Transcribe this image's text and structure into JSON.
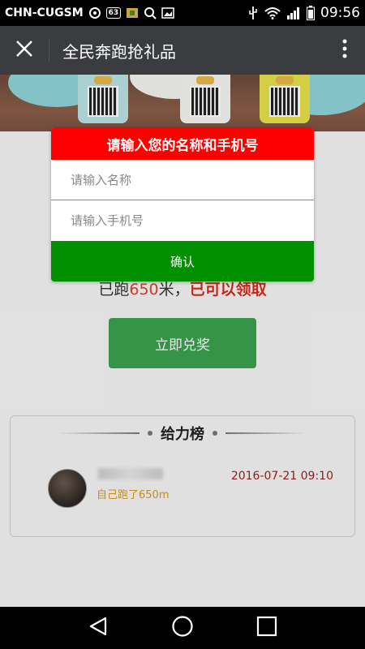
{
  "status_bar": {
    "carrier": "CHN-CUGSM",
    "notification_badge": "63",
    "time": "09:56",
    "icons": [
      "sync-icon",
      "notification-count-icon",
      "app-box-icon",
      "search-icon",
      "image-icon",
      "usb-icon",
      "wifi-icon",
      "signal-icon",
      "battery-icon"
    ]
  },
  "app_bar": {
    "title": "全民奔跑抢礼品",
    "icons": [
      "close-icon",
      "more-vert-icon"
    ]
  },
  "dialog": {
    "title": "请输入您的名称和手机号",
    "name_placeholder": "请输入名称",
    "name_value": "",
    "phone_placeholder": "请输入手机号",
    "phone_value": "",
    "confirm_label": "确认"
  },
  "run_status": {
    "prefix": "已跑",
    "distance": "650",
    "suffix": "米，",
    "claim_text": "已可以领取"
  },
  "redeem_button": {
    "label": "立即兑奖"
  },
  "leaderboard": {
    "title": "给力榜",
    "entries": [
      {
        "desc": "自己跑了650m",
        "time": "2016-07-21 09:10"
      }
    ]
  },
  "nav_bar": {
    "icons": [
      "back-icon",
      "home-icon",
      "recents-icon"
    ]
  },
  "colors": {
    "dialog_header": "#ff0000",
    "confirm_button": "#009000",
    "redeem_button": "#3aa14f",
    "app_bar": "#3a3c40",
    "accent_red": "#d62b1e"
  }
}
